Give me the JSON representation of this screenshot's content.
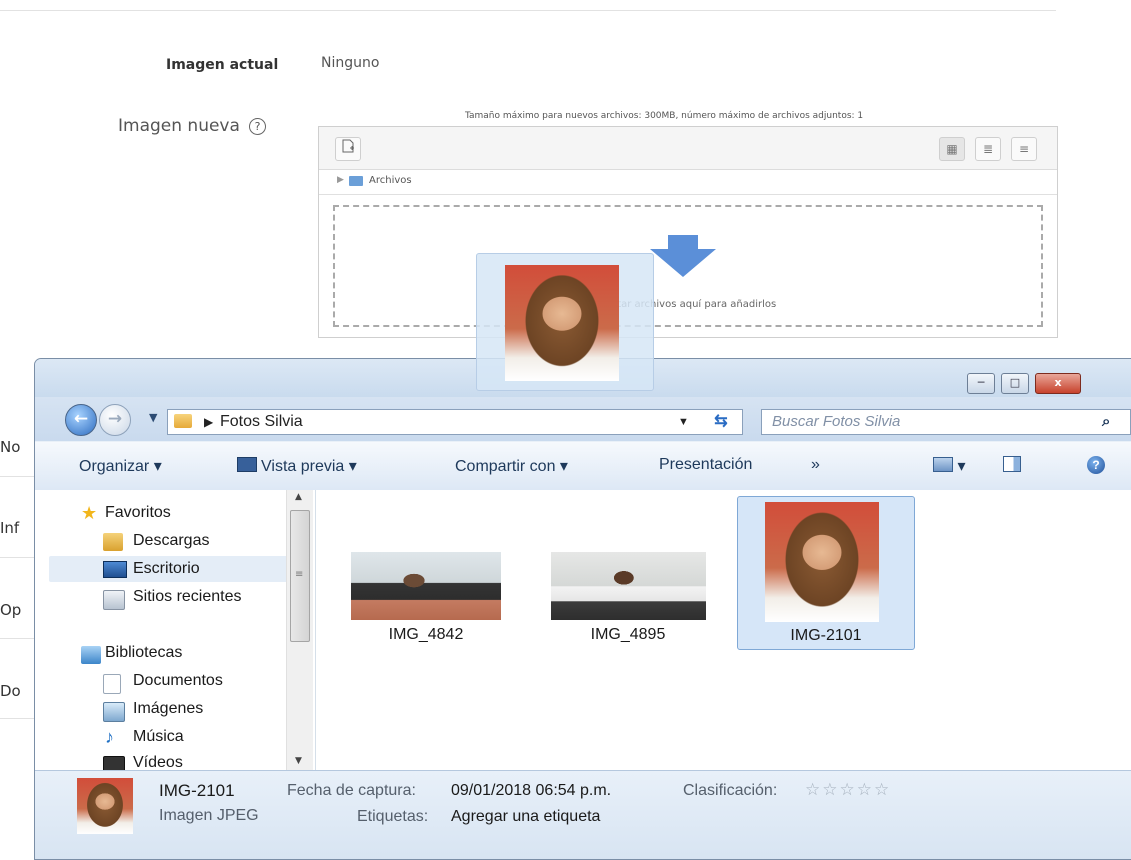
{
  "form": {
    "current_image_label": "Imagen actual",
    "current_image_value": "Ninguno",
    "new_image_label": "Imagen nueva",
    "help_icon": "question-circle-icon",
    "limits_text": "Tamaño máximo para nuevos archivos: 300MB, número máximo de archivos adjuntos: 1",
    "path_label": "Archivos",
    "drop_text": "Puede arrastrar y soltar archivos aquí para añadirlos",
    "truncated_labels": [
      "No",
      "Inf",
      "Op",
      "Do"
    ]
  },
  "explorer": {
    "caption_buttons": [
      "─",
      "□",
      "x"
    ],
    "address": {
      "folder": "Fotos Silvia"
    },
    "search_placeholder": "Buscar Fotos Silvia",
    "toolbar": {
      "organize": "Organizar",
      "preview": "Vista previa",
      "share": "Compartir con",
      "slideshow": "Presentación",
      "more": "»"
    },
    "nav": {
      "favorites": "Favoritos",
      "downloads": "Descargas",
      "desktop": "Escritorio",
      "recent": "Sitios recientes",
      "libraries": "Bibliotecas",
      "documents": "Documentos",
      "images": "Imágenes",
      "music": "Música",
      "videos": "Vídeos"
    },
    "files": [
      {
        "name": "IMG_4842"
      },
      {
        "name": "IMG_4895"
      },
      {
        "name": "IMG-2101"
      }
    ],
    "details": {
      "name": "IMG-2101",
      "type": "Imagen JPEG",
      "date_label": "Fecha de captura:",
      "date_value": "09/01/2018 06:54 p.m.",
      "tags_label": "Etiquetas:",
      "tags_value": "Agregar una etiqueta",
      "rating_label": "Clasificación:",
      "rating_stars": "☆☆☆☆☆"
    }
  },
  "colors": {
    "accent_blue": "#5b8fd8",
    "selection": "#d6e6f8",
    "close_red": "#c7422c"
  }
}
